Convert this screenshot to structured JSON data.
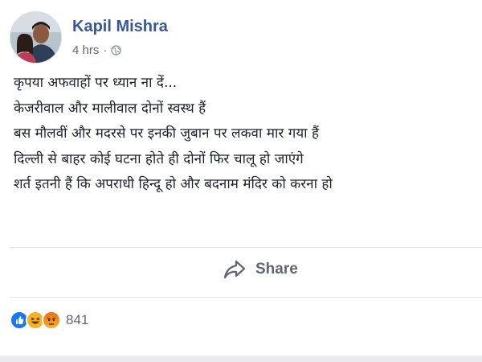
{
  "post": {
    "author": "Kapil Mishra",
    "timestamp": "4 hrs",
    "separator": "·",
    "privacy_icon": "globe-icon",
    "lines": [
      "कृपया अफवाहों पर ध्यान ना दें...",
      "केजरीवाल और मालीवाल दोनों स्वस्थ हैं",
      "बस मौलवीं और मदरसे पर इनकी जुबान पर लकवा मार गया हैं",
      "दिल्ली से बाहर कोई घटना होते ही दोनों फिर चालू हो जाएंगे",
      "शर्त इतनी हैं कि अपराधी हिन्दू हो और बदनाम मंदिर को करना हो"
    ]
  },
  "actions": {
    "share_label": "Share",
    "share_icon": "share-arrow-icon"
  },
  "reactions": {
    "icons": [
      "like-icon",
      "haha-icon",
      "angry-icon"
    ],
    "count": "841"
  },
  "colors": {
    "author": "#365899",
    "meta": "#616770",
    "like": "#1877f2",
    "haha": "#f7b125",
    "angry": "#e9710f"
  }
}
